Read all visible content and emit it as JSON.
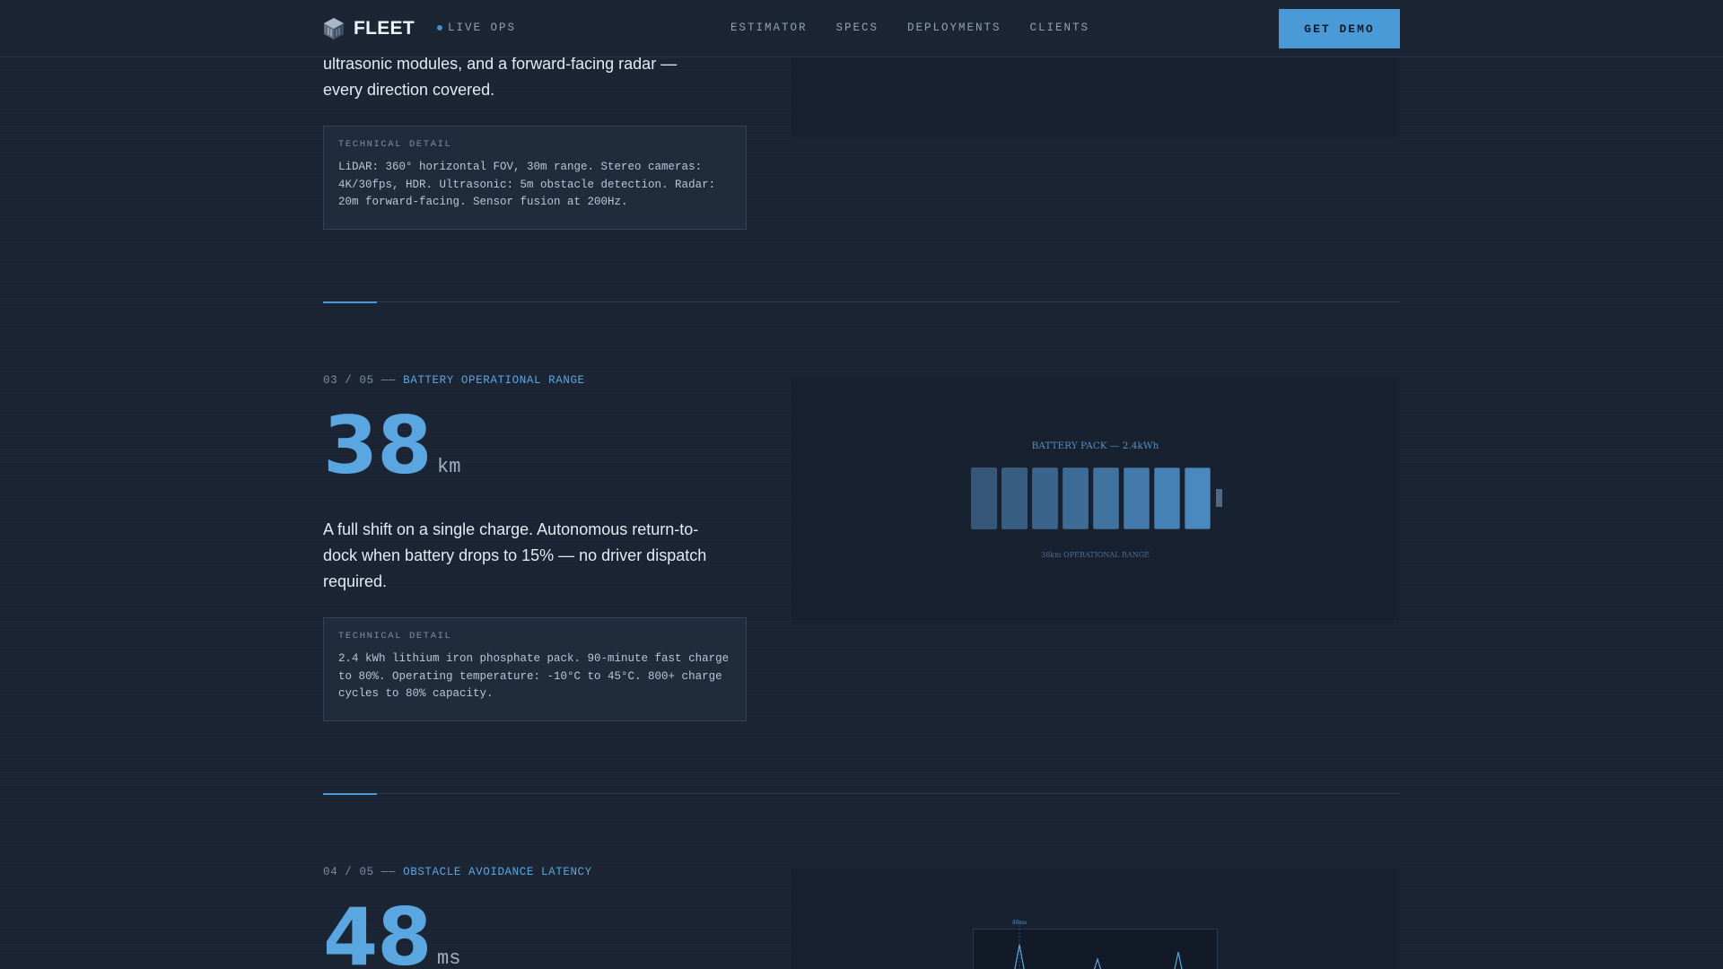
{
  "nav": {
    "logo_text": "FLEET",
    "status": "LIVE OPS",
    "links": [
      "ESTIMATOR",
      "SPECS",
      "DEPLOYMENTS",
      "CLIENTS"
    ],
    "cta": "GET DEMO"
  },
  "section2": {
    "desc": "ultrasonic modules, and a forward-facing radar — every direction covered.",
    "tech_label": "TECHNICAL DETAIL",
    "tech_body": "LiDAR: 360° horizontal FOV, 30m range. Stereo cameras: 4K/30fps, HDR. Ultrasonic: 5m obstacle detection. Radar: 20m forward-facing. Sensor fusion at 200Hz."
  },
  "section3": {
    "index": "03 / 05 ——",
    "title": "BATTERY OPERATIONAL RANGE",
    "value": "38",
    "unit": "km",
    "desc": "A full shift on a single charge. Autonomous return-to-dock when battery drops to 15% — no driver dispatch required.",
    "tech_label": "TECHNICAL DETAIL",
    "tech_body": "2.4 kWh lithium iron phosphate pack. 90-minute fast charge to 80%. Operating temperature: -10°C to 45°C. 800+ charge cycles to 80% capacity.",
    "chart_title": "BATTERY PACK — 2.4kWh",
    "chart_caption": "38km OPERATIONAL RANGE",
    "cells": 8
  },
  "section4": {
    "index": "04 / 05 ——",
    "title": "OBSTACLE AVOIDANCE LATENCY",
    "value": "48",
    "unit": "ms",
    "chart_marker": "48ms"
  },
  "colors": {
    "accent": "#4a9ad8",
    "background": "#1a2433",
    "panel": "#172130"
  }
}
